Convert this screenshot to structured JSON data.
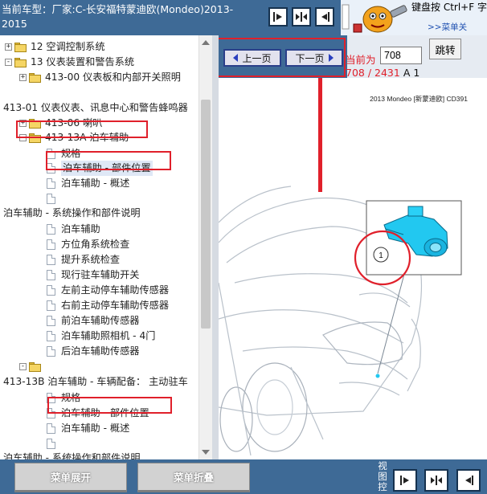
{
  "header": {
    "title": "当前车型：厂家:C-长安福特蒙迪欧(Mondeo)2013-2015",
    "help_tip": "键盘按 Ctrl+F 字!",
    "help_link": ">>菜单关"
  },
  "tree": {
    "items": [
      {
        "label": "12 空调控制系统",
        "type": "folder",
        "expander": "+"
      },
      {
        "label": "13 仪表装置和警告系统",
        "type": "folder",
        "expander": "-"
      },
      {
        "label": "413-00 仪表板和内部开关照明",
        "type": "folder",
        "expander": "+"
      },
      {
        "label": "413-01 仪表仪表、讯息中心和警告蜂鸣器",
        "type": "text"
      },
      {
        "label": "413-06 喇叭",
        "type": "folder",
        "expander": "+"
      },
      {
        "label": "413-13A 泊车辅助",
        "type": "folder",
        "expander": "-"
      },
      {
        "label": "规格",
        "type": "doc"
      },
      {
        "label": "泊车辅助 - 部件位置",
        "type": "doc",
        "selected": true
      },
      {
        "label": "泊车辅助 - 概述",
        "type": "doc"
      },
      {
        "label": "",
        "type": "doc"
      },
      {
        "label": "泊车辅助 - 系统操作和部件说明",
        "type": "text"
      },
      {
        "label": "泊车辅助",
        "type": "doc"
      },
      {
        "label": "方位角系统检查",
        "type": "doc"
      },
      {
        "label": "提升系统检查",
        "type": "doc"
      },
      {
        "label": "现行驻车辅助开关",
        "type": "doc"
      },
      {
        "label": "左前主动停车辅助传感器",
        "type": "doc"
      },
      {
        "label": "右前主动停车辅助传感器",
        "type": "doc"
      },
      {
        "label": "前泊车辅助传感器",
        "type": "doc"
      },
      {
        "label": "泊车辅助照相机 - 4门",
        "type": "doc"
      },
      {
        "label": "后泊车辅助传感器",
        "type": "doc"
      },
      {
        "label": "",
        "type": "folder",
        "expander": "-"
      },
      {
        "label": "413-13B 泊车辅助 - 车辆配备： 主动驻车",
        "type": "text"
      },
      {
        "label": "规格",
        "type": "doc"
      },
      {
        "label": "泊车辅助 - 部件位置",
        "type": "doc"
      },
      {
        "label": "泊车辅助 - 概述",
        "type": "doc"
      },
      {
        "label": "",
        "type": "doc"
      },
      {
        "label": "泊车辅助 - 系统操作和部件说明",
        "type": "text"
      }
    ]
  },
  "nav": {
    "prev_label": "上一页",
    "next_label": "下一页",
    "current_label": "当前为",
    "page_value": "708",
    "go_label": "跳转",
    "page_current": "708",
    "page_total": "2431",
    "page_suffix": "A 1"
  },
  "document": {
    "caption": "2013 Mondeo [新蒙迪欧] CD391",
    "callout": "1"
  },
  "bottom": {
    "expand_label": "菜单展开",
    "collapse_label": "菜单折叠",
    "view_label": "视图控"
  },
  "colors": {
    "header_bg": "#3e6a96",
    "highlight_red": "#e0202b",
    "component_cyan": "#22c8f0"
  },
  "icons": [
    "single-pane-icon",
    "dual-pane-icon",
    "text-pane-icon",
    "folder-icon",
    "document-icon",
    "prev-arrow-icon",
    "next-arrow-icon"
  ]
}
